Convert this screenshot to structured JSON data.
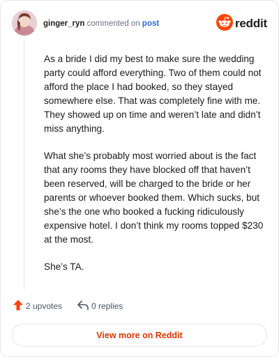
{
  "header": {
    "username": "ginger_ryn",
    "action_text": "commented on",
    "post_link": "post",
    "brand": "reddit"
  },
  "comment": {
    "paragraphs": [
      "As a bride I did my best to make sure the wedding party could afford everything. Two of them could not afford the place I had booked, so they stayed somewhere else. That was completely fine with me. They showed up on time and weren’t late and didn’t miss anything.",
      "What she’s probably most worried about is the fact that any rooms they have blocked off that haven’t been reserved, will be charged to the bride or her parents or whoever booked them. Which sucks, but she’s the one who booked a fucking ridiculously expensive hotel. I don’t think my rooms topped $230 at the most.",
      "She’s TA."
    ]
  },
  "actions": {
    "upvotes": "2 upvotes",
    "replies": "0 replies"
  },
  "footer": {
    "view_button": "View more on Reddit"
  },
  "colors": {
    "accent": "#FF4500",
    "link": "#2b6cd6",
    "button_text": "#d93a00"
  },
  "icons": {
    "brand": "reddit-logo-icon",
    "upvote": "upvote-arrow-icon",
    "reply": "reply-arrow-icon"
  }
}
